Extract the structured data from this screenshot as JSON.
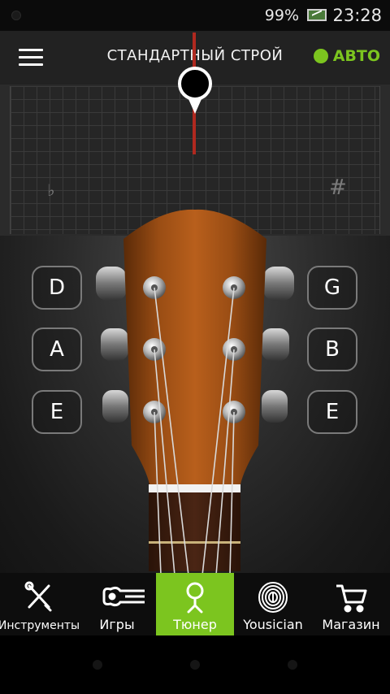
{
  "status_bar": {
    "battery": "99%",
    "time": "23:28"
  },
  "header": {
    "title": "СТАНДАРТНЫЙ СТРОЙ",
    "auto_label": "АВТО",
    "accent_color": "#7cc51f"
  },
  "meter": {
    "flat_symbol": "♭",
    "sharp_symbol": "#",
    "needle_color": "#b0291f"
  },
  "strings": {
    "left": [
      "D",
      "A",
      "E"
    ],
    "right": [
      "G",
      "B",
      "E"
    ]
  },
  "bottom_nav": {
    "items": [
      {
        "label": "Инструменты",
        "icon": "tools-icon",
        "active": false
      },
      {
        "label": "Игры",
        "icon": "ukulele-icon",
        "active": false
      },
      {
        "label": "Тюнер",
        "icon": "tuner-icon",
        "active": true
      },
      {
        "label": "Yousician",
        "icon": "fingerprint-icon",
        "active": false
      },
      {
        "label": "Магазин",
        "icon": "cart-icon",
        "active": false
      }
    ]
  }
}
